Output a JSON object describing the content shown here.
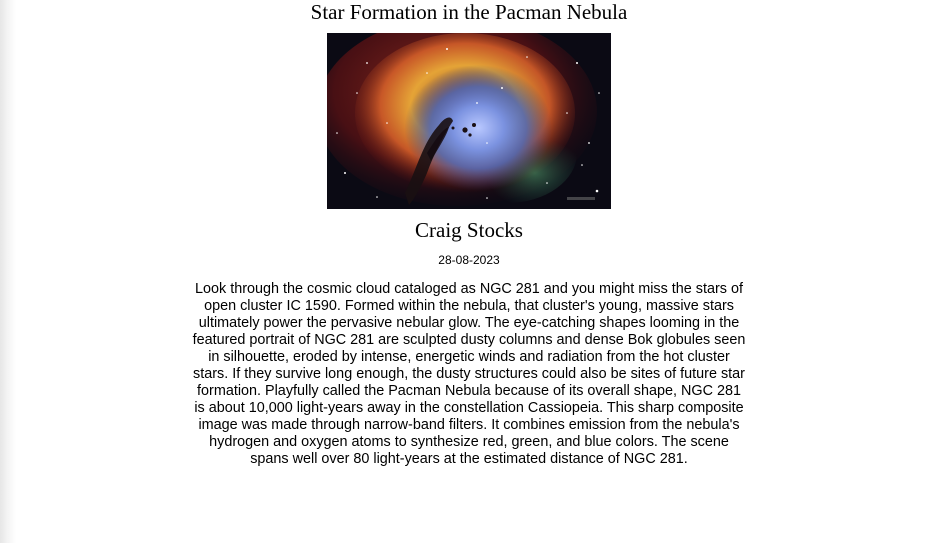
{
  "title": "Star Formation in the Pacman Nebula",
  "image": {
    "subject": "NGC 281 nebula"
  },
  "author": "Craig Stocks",
  "date": "28-08-2023",
  "explanation": "Look through the cosmic cloud cataloged as NGC 281 and you might miss the stars of open cluster IC 1590. Formed within the nebula, that cluster's young, massive stars ultimately power the pervasive nebular glow. The eye-catching shapes looming in the featured portrait of NGC 281 are sculpted dusty columns and dense Bok globules seen in silhouette, eroded by intense, energetic winds and radiation from the hot cluster stars. If they survive long enough, the dusty structures could also be sites of future star formation. Playfully called the Pacman Nebula because of its overall shape, NGC 281 is about 10,000 light-years away in the constellation Cassiopeia. This sharp composite image was made through narrow-band filters. It combines emission from the nebula's hydrogen and oxygen atoms to synthesize red, green, and blue colors. The scene spans well over 80 light-years at the estimated distance of NGC 281."
}
